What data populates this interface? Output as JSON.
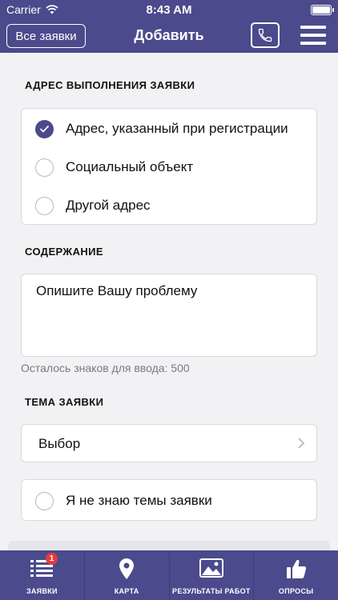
{
  "status_bar": {
    "carrier": "Carrier",
    "time": "8:43 AM",
    "battery_level": 1.0
  },
  "header": {
    "all_requests_label": "Все заявки",
    "title": "Добавить"
  },
  "address_section": {
    "title": "АДРЕС ВЫПОЛНЕНИЯ ЗАЯВКИ",
    "options": [
      {
        "label": "Адрес, указанный при регистрации",
        "checked": true
      },
      {
        "label": "Социальный объект",
        "checked": false
      },
      {
        "label": "Другой адрес",
        "checked": false
      }
    ]
  },
  "content_section": {
    "title": "СОДЕРЖАНИЕ",
    "placeholder": "Опишите Вашу проблему",
    "counter": "Осталось знаков для ввода: 500"
  },
  "topic_section": {
    "title": "ТЕМА ЗАЯВКИ",
    "select_value": "Выбор",
    "unknown_label": "Я не знаю темы заявки",
    "unknown_checked": false
  },
  "tabbar": {
    "tabs": [
      {
        "label": "ЗАЯВКИ",
        "icon": "list-icon",
        "badge": "1"
      },
      {
        "label": "КАРТА",
        "icon": "map-pin-icon"
      },
      {
        "label": "РЕЗУЛЬТАТЫ РАБОТ",
        "icon": "image-icon"
      },
      {
        "label": "ОПРОСЫ",
        "icon": "thumbs-up-icon"
      }
    ]
  },
  "colors": {
    "primary": "#4a4a8c",
    "badge": "#e43b3b",
    "background": "#f2f2f4"
  }
}
